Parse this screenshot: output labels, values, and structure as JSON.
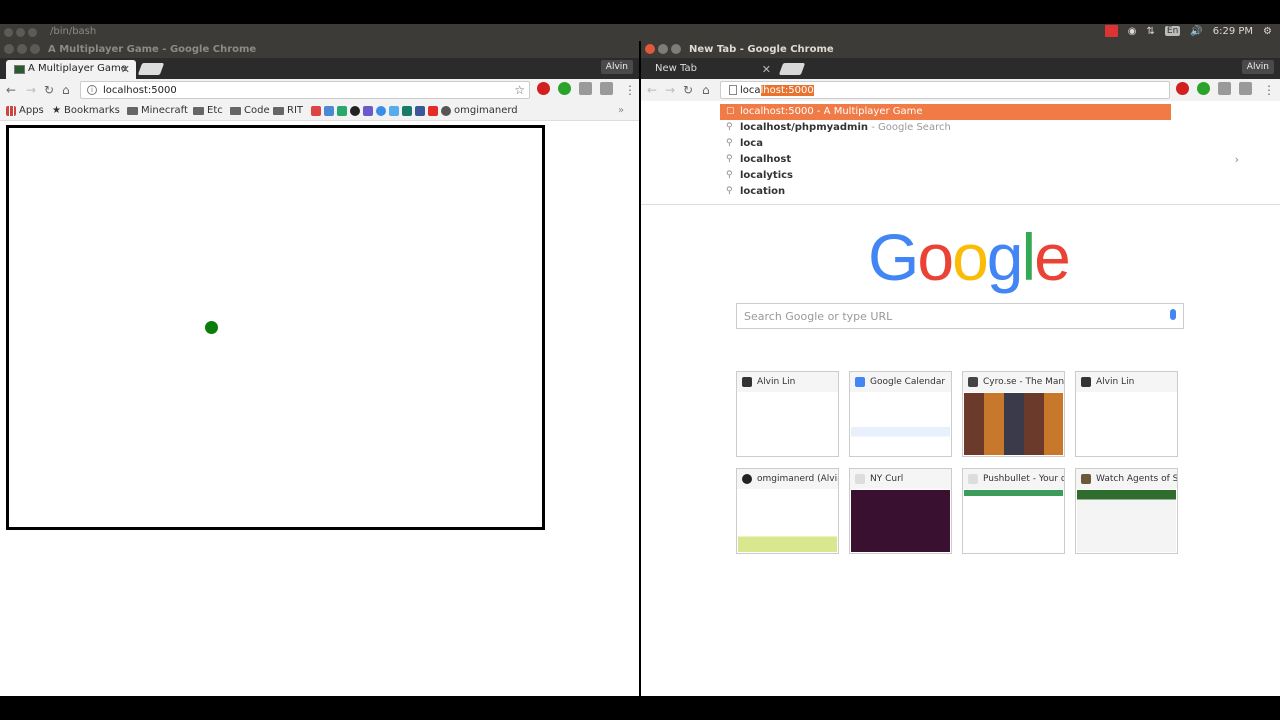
{
  "panel": {
    "left_title": "/bin/bash",
    "language": "En",
    "time": "6:29 PM"
  },
  "left_window": {
    "title": "A Multiplayer Game - Google Chrome",
    "tab_label": "A Multiplayer Game",
    "profile": "Alvin",
    "url": "localhost:5000",
    "bookmarks": [
      "Apps",
      "Bookmarks",
      "Minecraft",
      "Etc",
      "Code",
      "RIT",
      "omgimanerd"
    ],
    "more": "»"
  },
  "right_window": {
    "title": "New Tab - Google Chrome",
    "tab_label": "New Tab",
    "profile": "Alvin",
    "url_typed": "loca",
    "url_autocomplete": "lhost:5000",
    "suggestions": [
      {
        "strong": "localhost:5000",
        "rest": " - A Multiplayer Game"
      },
      {
        "strong": "localhost/phpmyadmin",
        "rest": " - Google Search"
      },
      {
        "strong": "loca",
        "rest": ""
      },
      {
        "strong": "localhost",
        "rest": ""
      },
      {
        "strong": "localytics",
        "rest": ""
      },
      {
        "strong": "location",
        "rest": ""
      }
    ],
    "search_placeholder": "Search Google or type URL",
    "logo": [
      "G",
      "o",
      "o",
      "g",
      "l",
      "e"
    ],
    "tiles": [
      "Alvin Lin",
      "Google Calendar",
      "Cyro.se - The Many-M",
      "Alvin Lin",
      "omgimanerd (Alvin Li",
      "NY Curl",
      "Pushbullet - Your devi",
      "Watch Agents of S.H."
    ]
  },
  "colors": {
    "autocomplete_highlight": "#f07b47",
    "player_dot": "#0a7d0a"
  }
}
